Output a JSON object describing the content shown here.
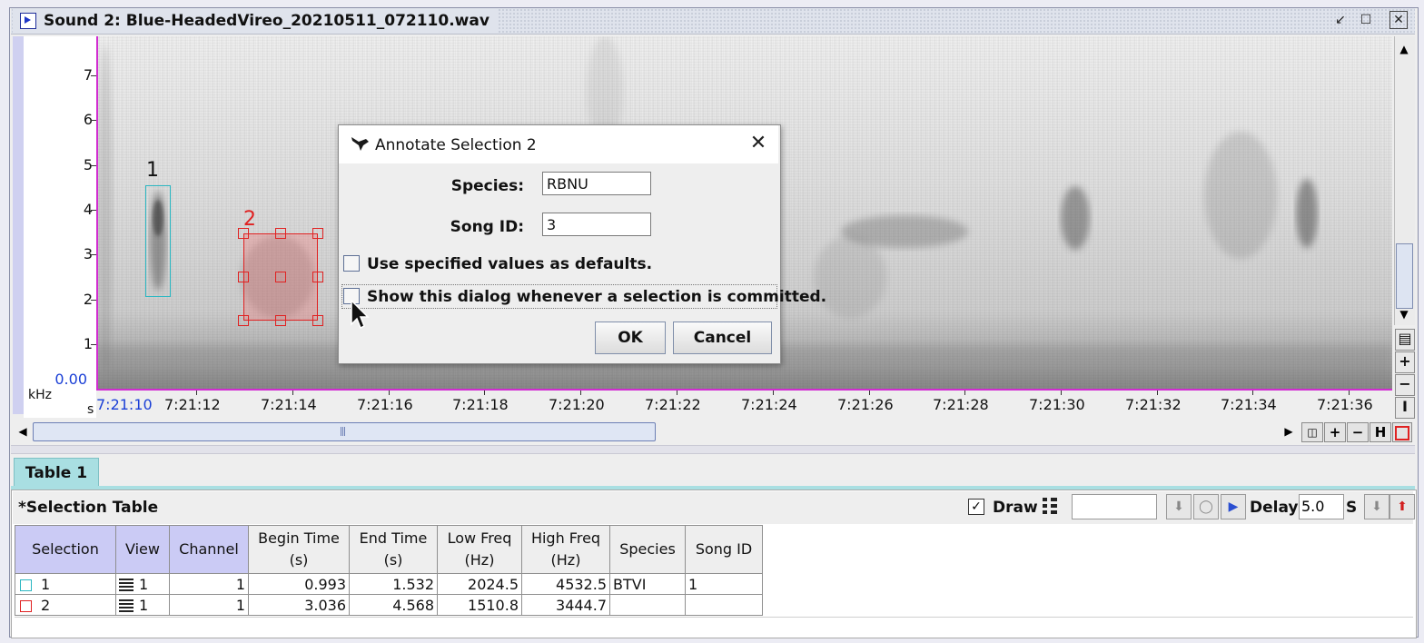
{
  "window": {
    "title": "Sound 2: Blue-HeadedVireo_20210511_072110.wav"
  },
  "spectrogram": {
    "y_unit": "kHz",
    "x_unit": "s",
    "y_ticks": [
      "7",
      "6",
      "5",
      "4",
      "3",
      "2",
      "1",
      "0.00"
    ],
    "x_ticks": [
      "7:21:10",
      "7:21:12",
      "7:21:14",
      "7:21:16",
      "7:21:18",
      "7:21:20",
      "7:21:22",
      "7:21:24",
      "7:21:26",
      "7:21:28",
      "7:21:30",
      "7:21:32",
      "7:21:34",
      "7:21:36"
    ],
    "selections": [
      {
        "label": "1",
        "color": "#2bb7c2"
      },
      {
        "label": "2",
        "color": "#e02222"
      }
    ]
  },
  "icons": {
    "window": "sound-window-icon",
    "minimize": "minimize-icon",
    "maximize": "maximize-icon",
    "close": "close-icon",
    "dialog": "bird-icon"
  },
  "dialog": {
    "title": "Annotate Selection 2",
    "species_label": "Species:",
    "species_value": "RBNU",
    "songid_label": "Song ID:",
    "songid_value": "3",
    "check1_label": "Use specified values as defaults.",
    "check2_label": "Show this dialog whenever a selection is committed.",
    "ok": "OK",
    "cancel": "Cancel"
  },
  "sidebuttons": {
    "fit": "▤",
    "zoom_in": "+",
    "zoom_out": "−",
    "fit_v": "I"
  },
  "hbuttons": {
    "plus": "+",
    "minus": "−",
    "fit": "H"
  },
  "tab": {
    "label": "Table 1"
  },
  "table": {
    "caption": "*Selection Table",
    "draw_label": "Draw",
    "delay_label": "Delay:",
    "delay_value": "5.0",
    "delay_unit": "S",
    "columns": [
      {
        "l1": "Selection",
        "l2": ""
      },
      {
        "l1": "View",
        "l2": ""
      },
      {
        "l1": "Channel",
        "l2": ""
      },
      {
        "l1": "Begin Time",
        "l2": "(s)"
      },
      {
        "l1": "End Time",
        "l2": "(s)"
      },
      {
        "l1": "Low Freq",
        "l2": "(Hz)"
      },
      {
        "l1": "High Freq",
        "l2": "(Hz)"
      },
      {
        "l1": "Species",
        "l2": ""
      },
      {
        "l1": "Song ID",
        "l2": ""
      }
    ],
    "rows": [
      {
        "selection": "1",
        "view": "1",
        "channel": "1",
        "begin": "0.993",
        "end": "1.532",
        "low": "2024.5",
        "high": "4532.5",
        "species": "BTVI",
        "songid": "1",
        "color": "#2bb7c2"
      },
      {
        "selection": "2",
        "view": "1",
        "channel": "1",
        "begin": "3.036",
        "end": "4.568",
        "low": "1510.8",
        "high": "3444.7",
        "species": "",
        "songid": "",
        "color": "#e02222"
      }
    ]
  }
}
